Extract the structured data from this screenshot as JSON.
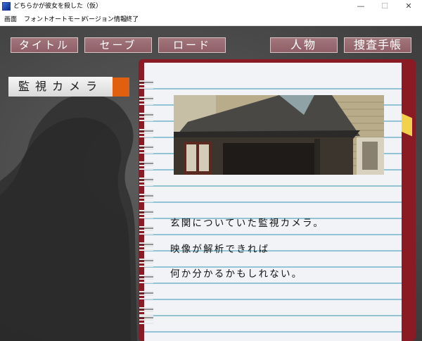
{
  "window": {
    "title": "どちらかが彼女を殺した（仮）",
    "minimize": "—",
    "maximize": "☐",
    "close": "✕"
  },
  "menubar": {
    "items": [
      "画面",
      "フォント",
      "オートモード",
      "バージョン情報",
      "終了"
    ]
  },
  "nav": {
    "title_label": "タイトル",
    "save_label": "セーブ",
    "load_label": "ロード",
    "characters_label": "人物",
    "notebook_label": "捜査手帳"
  },
  "clue": {
    "name": "監視カメラ",
    "description": [
      "玄関についていた監視カメラ。",
      "映像が解析できれば",
      "何か分かるかもしれない。"
    ]
  },
  "colors": {
    "button": "#9a6a71",
    "notebook_cover": "#8a1a24",
    "accent": "#e06010",
    "bookmark": "#f2d24a",
    "ruled_line": "#5aa9c4"
  }
}
